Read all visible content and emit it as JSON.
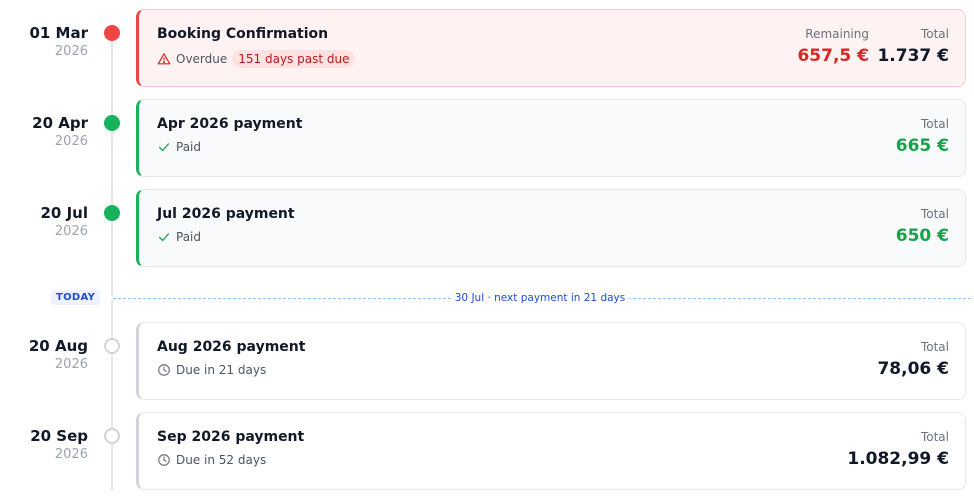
{
  "today": {
    "badge": "TODAY",
    "note": "30 Jul · next payment in 21 days"
  },
  "payments": [
    {
      "day": "01 Mar",
      "year": "2026",
      "title": "Booking Confirmation",
      "status": "Overdue",
      "status_pill": "151 days past due",
      "remaining_label": "Remaining",
      "remaining_value": "657,5 €",
      "total_label": "Total",
      "total_value": "1.737 €"
    },
    {
      "day": "20 Apr",
      "year": "2026",
      "title": "Apr 2026 payment",
      "status": "Paid",
      "total_label": "Total",
      "total_value": "665 €"
    },
    {
      "day": "20 Jul",
      "year": "2026",
      "title": "Jul 2026 payment",
      "status": "Paid",
      "total_label": "Total",
      "total_value": "650 €"
    },
    {
      "day": "20 Aug",
      "year": "2026",
      "title": "Aug 2026 payment",
      "status": "Due in 21 days",
      "total_label": "Total",
      "total_value": "78,06 €"
    },
    {
      "day": "20 Sep",
      "year": "2026",
      "title": "Sep 2026 payment",
      "status": "Due in 52 days",
      "total_label": "Total",
      "total_value": "1.082,99 €"
    }
  ],
  "colors": {
    "overdue": "#ef4444",
    "paid": "#16b35a",
    "upcoming": "#d1d5db",
    "today_accent": "#1d4ed8"
  },
  "icons": {
    "overdue": "warning-triangle-icon",
    "paid": "check-icon",
    "upcoming": "clock-icon"
  }
}
